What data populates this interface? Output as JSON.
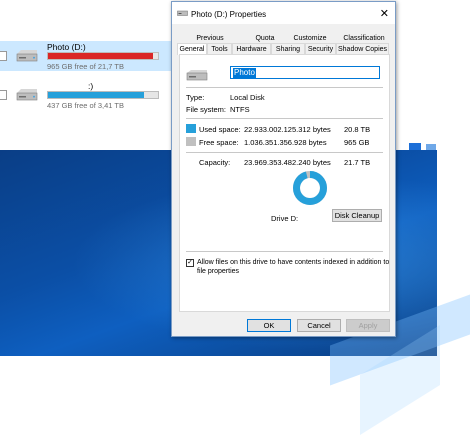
{
  "explorer": {
    "drives": [
      {
        "name": "Photo (D:)",
        "free_text": "965 GB free of 21,7 TB",
        "used_fraction": 0.956,
        "bar_color": "#da2626",
        "selected": true
      },
      {
        "name": ":)",
        "free_text": "437 GB free of 3,41 TB",
        "used_fraction": 0.875,
        "bar_color": "#26a0da",
        "selected": false
      }
    ]
  },
  "dialog": {
    "title": "Photo (D:) Properties",
    "close_glyph": "✕",
    "tabs_row1": [
      "Previous Versions",
      "Quota",
      "Customize",
      "Classification"
    ],
    "tabs_row2": [
      "General",
      "Tools",
      "Hardware",
      "Sharing",
      "Security",
      "Shadow Copies"
    ],
    "active_tab": "General",
    "volume_name": "Photo",
    "type_label": "Type:",
    "type_value": "Local Disk",
    "fs_label": "File system:",
    "fs_value": "NTFS",
    "used_label": "Used space:",
    "used_bytes": "22.933.002.125.312 bytes",
    "used_size": "20.8 TB",
    "free_label": "Free space:",
    "free_bytes": "1.036.351.356.928 bytes",
    "free_size": "965 GB",
    "capacity_label": "Capacity:",
    "capacity_bytes": "23.969.353.482.240 bytes",
    "capacity_size": "21.7 TB",
    "drive_label": "Drive D:",
    "disk_cleanup": "Disk Cleanup",
    "index_checked": true,
    "index_text_line1": "Allow files on this drive to have contents indexed in addition to",
    "index_text_line2": "file properties",
    "ok": "OK",
    "cancel": "Cancel",
    "apply": "Apply",
    "used_fraction": 0.957,
    "colors": {
      "used": "#26a0da",
      "free": "#c0c0c0",
      "accent": "#0078d7"
    }
  }
}
